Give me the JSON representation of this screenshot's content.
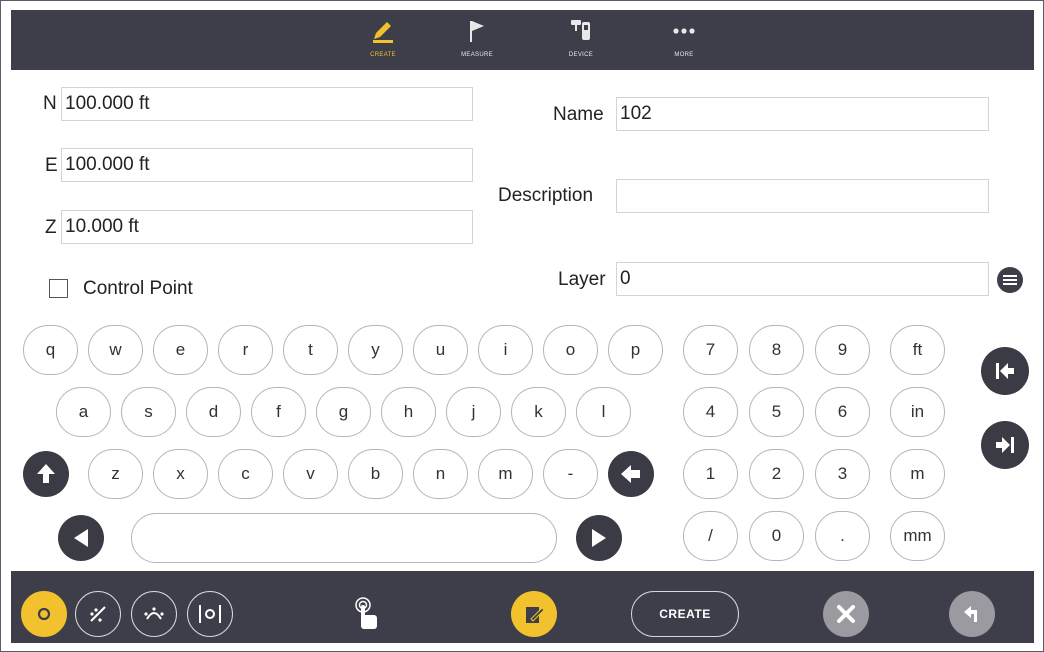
{
  "nav": {
    "items": [
      {
        "label": "CREATE",
        "icon": "pencil-icon",
        "active": true
      },
      {
        "label": "MEASURE",
        "icon": "flag-icon",
        "active": false
      },
      {
        "label": "DEVICE",
        "icon": "device-icon",
        "active": false
      },
      {
        "label": "MORE",
        "icon": "more-icon",
        "active": false
      }
    ]
  },
  "form": {
    "n_label": "N",
    "n_value": "100.000 ft",
    "e_label": "E",
    "e_value": "100.000 ft",
    "z_label": "Z",
    "z_value": "10.000 ft",
    "control_point_label": "Control Point",
    "control_point_checked": false,
    "name_label": "Name",
    "name_value": "102",
    "description_label": "Description",
    "description_value": "",
    "layer_label": "Layer",
    "layer_value": "0"
  },
  "keyboard": {
    "row1": [
      "q",
      "w",
      "e",
      "r",
      "t",
      "y",
      "u",
      "i",
      "o",
      "p"
    ],
    "row2": [
      "a",
      "s",
      "d",
      "f",
      "g",
      "h",
      "j",
      "k",
      "l"
    ],
    "row3": [
      "z",
      "x",
      "c",
      "v",
      "b",
      "n",
      "m",
      "-"
    ],
    "numpad": [
      [
        "7",
        "8",
        "9",
        "ft"
      ],
      [
        "4",
        "5",
        "6",
        "in"
      ],
      [
        "1",
        "2",
        "3",
        "m"
      ],
      [
        "/",
        "0",
        ".",
        "mm"
      ]
    ]
  },
  "toolbar": {
    "create_label": "CREATE"
  },
  "colors": {
    "accent": "#f2c12e",
    "bar": "#3d3e49",
    "dark_key": "#3a3b44",
    "disabled": "#9a9aa0"
  }
}
